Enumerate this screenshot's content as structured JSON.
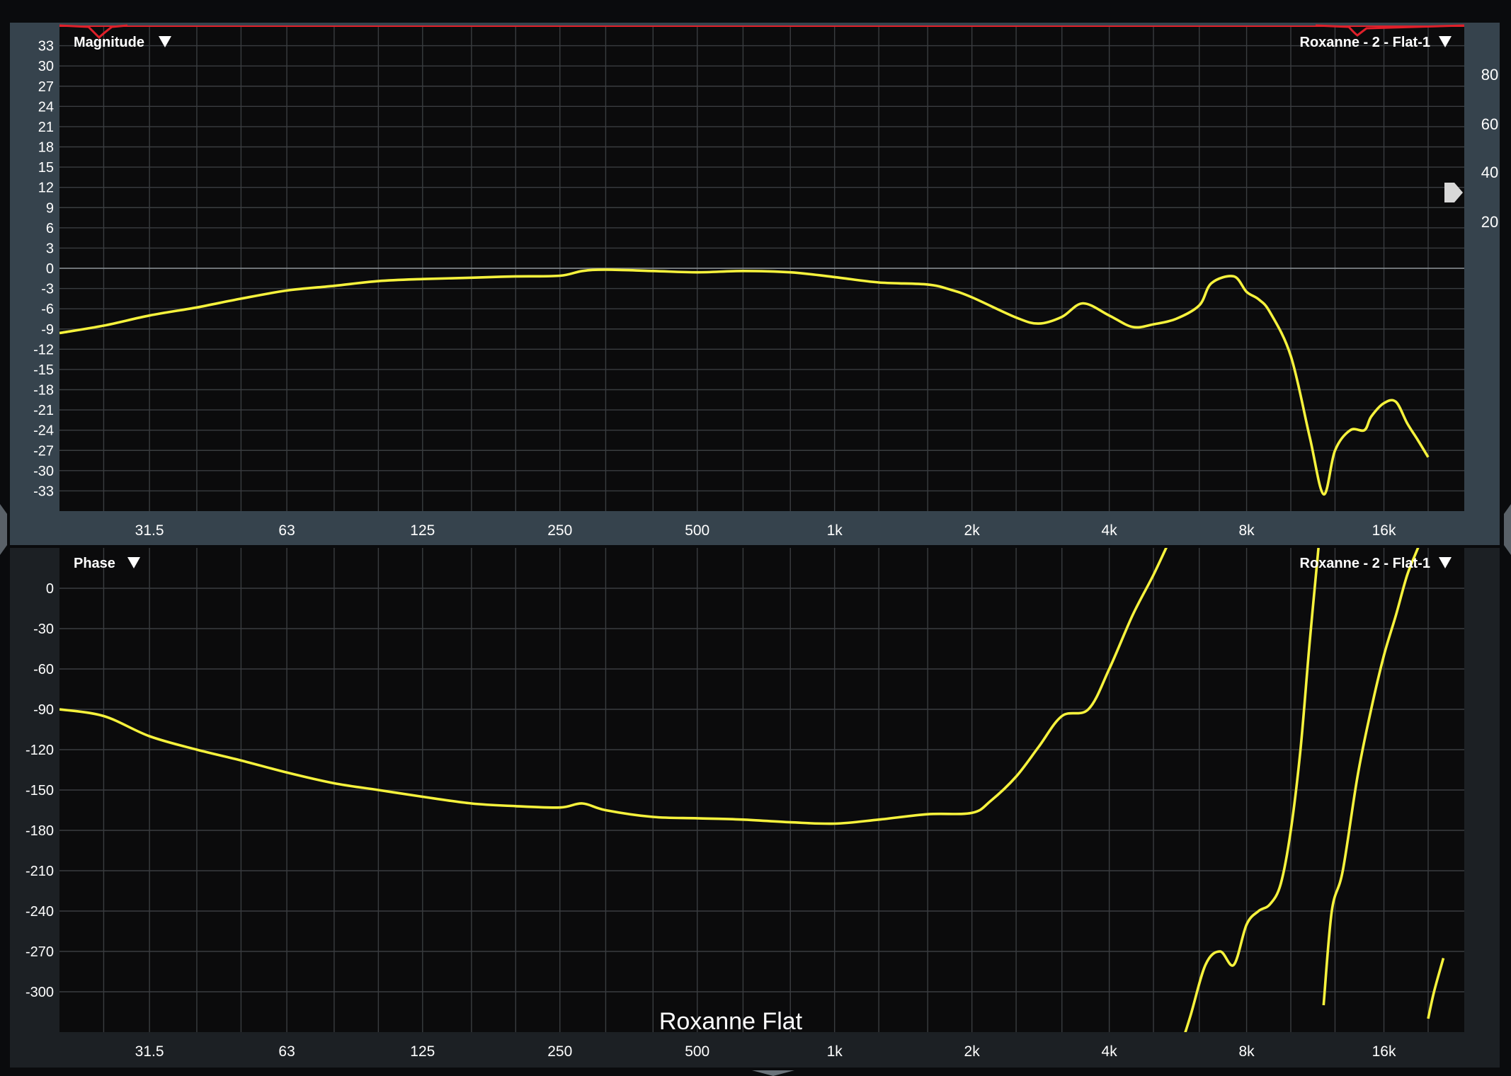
{
  "colors": {
    "background": "#0a0b0d",
    "magnitude_panel": "#36434d",
    "phase_panel": "#1c2024",
    "plot_bg": "#0b0b0c",
    "grid": "#3a3d40",
    "trace": "#f6f23c",
    "coherence": "#e0202a",
    "label": "#ffffff"
  },
  "caption": "Roxanne Flat",
  "icons": {
    "dropdown": "triangle-down-icon",
    "handle": "arrow-right-icon",
    "splitter": "chevron-down-icon",
    "side_tab": "chevron-side-icon"
  },
  "magnitude": {
    "title": "Magnitude",
    "trace_name": "Roxanne - 2 - Flat-1",
    "y_ticks": [
      "33",
      "30",
      "27",
      "24",
      "21",
      "18",
      "15",
      "12",
      "9",
      "6",
      "3",
      "0",
      "-3",
      "-6",
      "-9",
      "-12",
      "-15",
      "-18",
      "-21",
      "-24",
      "-27",
      "-30",
      "-33"
    ],
    "right_ticks": [
      "80",
      "60",
      "40",
      "20"
    ],
    "x_ticks": [
      "31.5",
      "63",
      "125",
      "250",
      "500",
      "1k",
      "2k",
      "4k",
      "8k",
      "16k"
    ]
  },
  "phase": {
    "title": "Phase",
    "trace_name": "Roxanne - 2 - Flat-1",
    "y_ticks": [
      "0",
      "-30",
      "-60",
      "-90",
      "-120",
      "-150",
      "-180",
      "-210",
      "-240",
      "-270",
      "-300"
    ],
    "x_ticks": [
      "31.5",
      "63",
      "125",
      "250",
      "500",
      "1k",
      "2k",
      "4k",
      "8k",
      "16k"
    ]
  },
  "chart_data": [
    {
      "type": "line",
      "title": "Magnitude",
      "x_scale": "log",
      "xlim": [
        20,
        24000
      ],
      "ylim": [
        -36,
        36
      ],
      "series": [
        {
          "name": "Roxanne - 2 - Flat-1",
          "x": [
            20,
            25,
            31.5,
            40,
            50,
            63,
            80,
            100,
            125,
            160,
            200,
            250,
            280,
            315,
            400,
            500,
            630,
            800,
            1000,
            1250,
            1600,
            1800,
            2000,
            2500,
            2800,
            3150,
            3500,
            4000,
            4500,
            5000,
            5600,
            6300,
            6700,
            7500,
            8000,
            8500,
            9000,
            10000,
            11000,
            11800,
            12500,
            13500,
            14500,
            15000,
            16000,
            17000,
            18000,
            19000,
            20000
          ],
          "y": [
            -9.6,
            -8.5,
            -7,
            -5.8,
            -4.5,
            -3.3,
            -2.6,
            -1.9,
            -1.6,
            -1.4,
            -1.2,
            -1.1,
            -0.4,
            -0.2,
            -0.4,
            -0.6,
            -0.4,
            -0.6,
            -1.3,
            -2.1,
            -2.4,
            -3.2,
            -4.3,
            -7.3,
            -8.2,
            -7.2,
            -5.2,
            -7,
            -8.7,
            -8.3,
            -7.5,
            -5.5,
            -2.2,
            -1.2,
            -3.5,
            -4.6,
            -6.5,
            -13,
            -25,
            -33.5,
            -27,
            -24,
            -24,
            -22,
            -20,
            -19.8,
            -23,
            -25.5,
            -28
          ]
        }
      ]
    },
    {
      "type": "line",
      "title": "Phase",
      "x_scale": "log",
      "xlim": [
        20,
        24000
      ],
      "ylim": [
        -330,
        30
      ],
      "series": [
        {
          "name": "Roxanne - 2 - Flat-1",
          "x": [
            20,
            25,
            31.5,
            40,
            50,
            63,
            80,
            100,
            125,
            160,
            200,
            250,
            280,
            315,
            400,
            500,
            630,
            800,
            1000,
            1250,
            1600,
            2000,
            2200,
            2500,
            2800,
            3150,
            3600,
            4000,
            4500,
            5000,
            5500
          ],
          "y": [
            -90,
            -95,
            -110,
            -120,
            -128,
            -137,
            -145,
            -150,
            -155,
            -160,
            -162,
            -163,
            -160,
            -165,
            -170,
            -171,
            -172,
            -174,
            -175,
            -172,
            -168,
            -167,
            -158,
            -140,
            -118,
            -95,
            -90,
            -60,
            -20,
            10,
            40
          ]
        },
        {
          "name": "Roxanne - 2 - Flat-1",
          "x": [
            5500,
            6000,
            6500,
            7000,
            7500,
            8000,
            8500,
            9000,
            9500,
            10000,
            10500,
            11000,
            11500
          ],
          "y": [
            -360,
            -320,
            -280,
            -270,
            -280,
            -250,
            -240,
            -235,
            -220,
            -180,
            -120,
            -40,
            30
          ]
        },
        {
          "name": "Roxanne - 2 - Flat-1",
          "x": [
            11800,
            12300,
            13000,
            14000,
            15000,
            16000,
            17000,
            18000,
            19000,
            20000
          ],
          "y": [
            -310,
            -240,
            -210,
            -140,
            -90,
            -50,
            -20,
            10,
            30,
            50
          ]
        },
        {
          "name": "Roxanne - 2 - Flat-1",
          "x": [
            20000,
            20600,
            21600
          ],
          "y": [
            -320,
            -300,
            -275
          ]
        }
      ]
    }
  ]
}
